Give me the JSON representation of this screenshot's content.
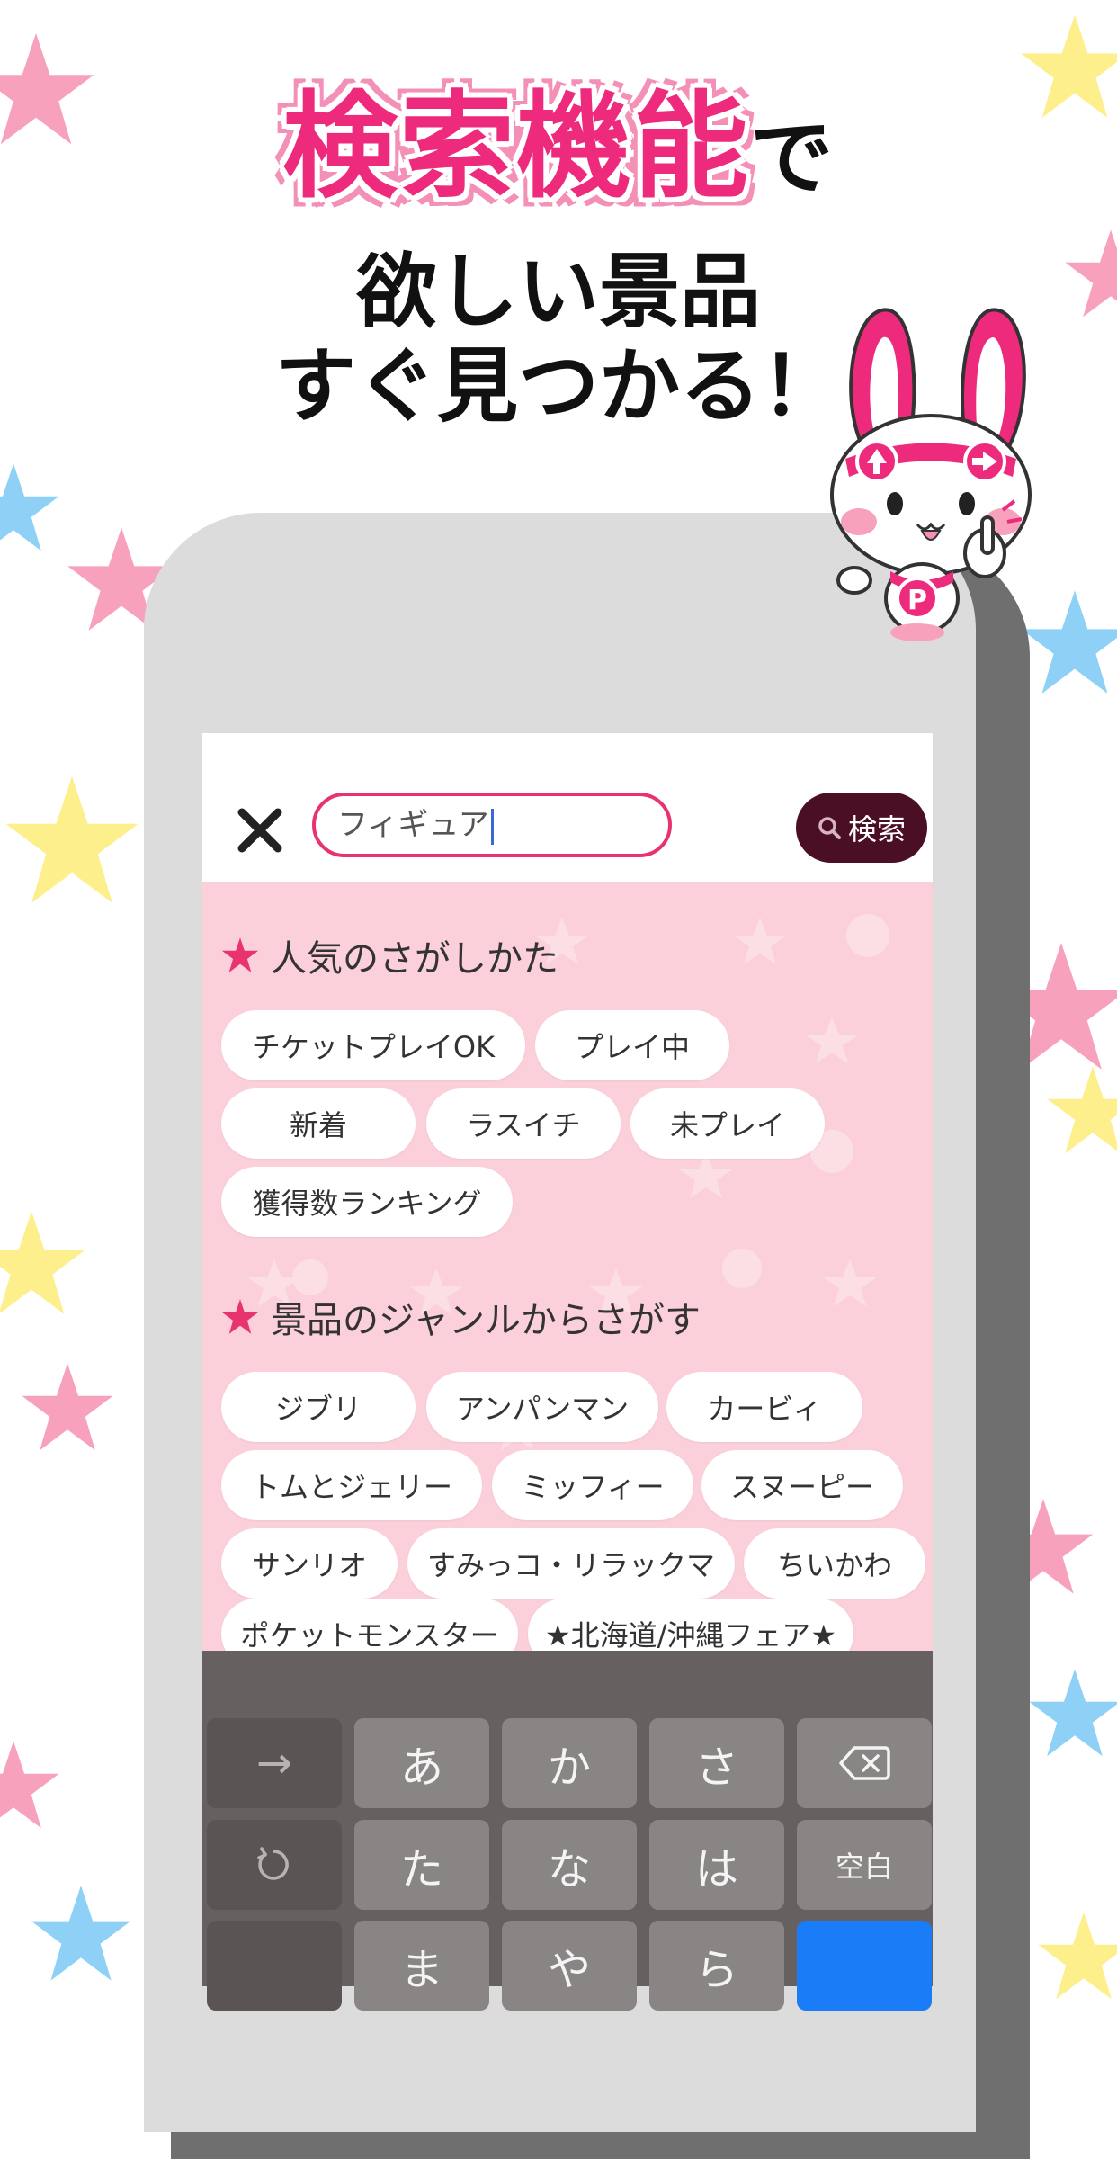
{
  "headline": {
    "line1_highlight": "検索機能",
    "line1_suffix": "で",
    "line2": "欲しい景品",
    "line3": "すぐ見つかる！"
  },
  "search": {
    "value": "フィギュア",
    "button_label": "検索"
  },
  "popular": {
    "title": "人気のさがしかた",
    "chips": [
      "チケットプレイOK",
      "プレイ中",
      "新着",
      "ラスイチ",
      "未プレイ",
      "獲得数ランキング"
    ]
  },
  "genre": {
    "title": "景品のジャンルからさがす",
    "chips": [
      "ジブリ",
      "アンパンマン",
      "カービィ",
      "トムとジェリー",
      "ミッフィー",
      "スヌーピー",
      "サンリオ",
      "すみっコ・リラックマ",
      "ちいかわ",
      "ポケットモンスター",
      "★北海道/沖縄フェア★"
    ]
  },
  "keyboard": {
    "row1": [
      "→",
      "あ",
      "か",
      "さ"
    ],
    "row2": [
      "な",
      "は",
      "空白"
    ],
    "row2_first": "た",
    "row3": [
      "ま",
      "や",
      "ら"
    ]
  },
  "colors": {
    "accent": "#ee2a7d",
    "screen_bg": "#fbd0da",
    "search_button": "#4a0f24",
    "keyboard_bg": "#666060",
    "return_key": "#1a7cf6"
  },
  "icons": {
    "close": "close-icon",
    "search": "search-icon",
    "backspace": "backspace-icon",
    "undo": "undo-icon",
    "section": "star-icon"
  }
}
